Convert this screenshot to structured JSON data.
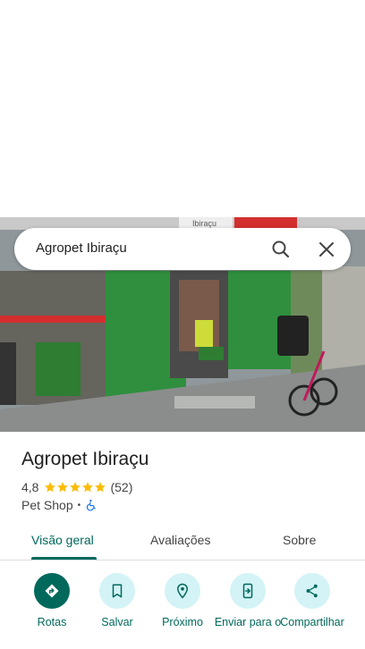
{
  "search": {
    "query": "Agropet Ibiraçu"
  },
  "place": {
    "name": "Agropet Ibiraçu",
    "rating": "4,8",
    "reviews_count": "(52)",
    "stars": 5,
    "category": "Pet Shop",
    "separator": "•"
  },
  "tabs": [
    {
      "label": "Visão geral",
      "active": true
    },
    {
      "label": "Avaliações",
      "active": false
    },
    {
      "label": "Sobre",
      "active": false
    }
  ],
  "actions": [
    {
      "label": "Rotas",
      "icon": "directions-icon"
    },
    {
      "label": "Salvar",
      "icon": "bookmark-icon"
    },
    {
      "label": "Próximo",
      "icon": "nearby-icon"
    },
    {
      "label": "Enviar para o",
      "icon": "send-to-phone-icon"
    },
    {
      "label": "Compartilhar",
      "icon": "share-icon"
    }
  ],
  "photo": {
    "sign_text": "Ibiraçu"
  },
  "colors": {
    "accent": "#00695c",
    "action_bg": "#d3f3f6",
    "star": "#fbbc04"
  }
}
